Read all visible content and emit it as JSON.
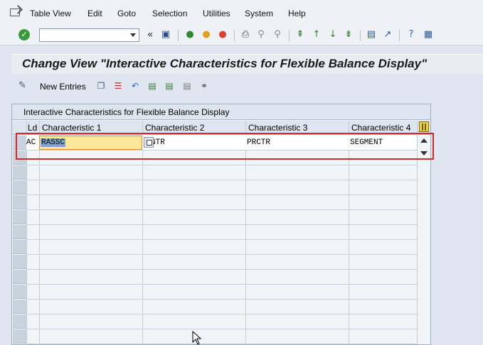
{
  "menu": {
    "items": [
      "Table View",
      "Edit",
      "Goto",
      "Selection",
      "Utilities",
      "System",
      "Help"
    ]
  },
  "toolbar": {
    "command_field_value": "",
    "icons": [
      "enter-icon",
      "back-icon",
      "save-icon",
      "back-green-icon",
      "exit-icon",
      "cancel-icon",
      "print-icon",
      "find-icon",
      "find-next-icon",
      "first-page-icon",
      "previous-page-icon",
      "next-page-icon",
      "last-page-icon",
      "create-session-icon",
      "shortcut-icon",
      "help-icon",
      "layout-icon"
    ]
  },
  "title": "Change View \"Interactive Characteristics for Flexible Balance Display\"",
  "app_toolbar": {
    "new_entries_label": "New Entries"
  },
  "table": {
    "caption": "Interactive Characteristics for Flexible Balance Display",
    "columns": [
      "Ld",
      "Characteristic 1",
      "Characteristic 2",
      "Characteristic 3",
      "Characteristic 4"
    ],
    "rows": [
      {
        "ld": "AC",
        "c1": "RASSC",
        "c2": "RCNTR",
        "c2_visible": "NTR",
        "c3": "PRCTR",
        "c4": "SEGMENT"
      }
    ]
  }
}
